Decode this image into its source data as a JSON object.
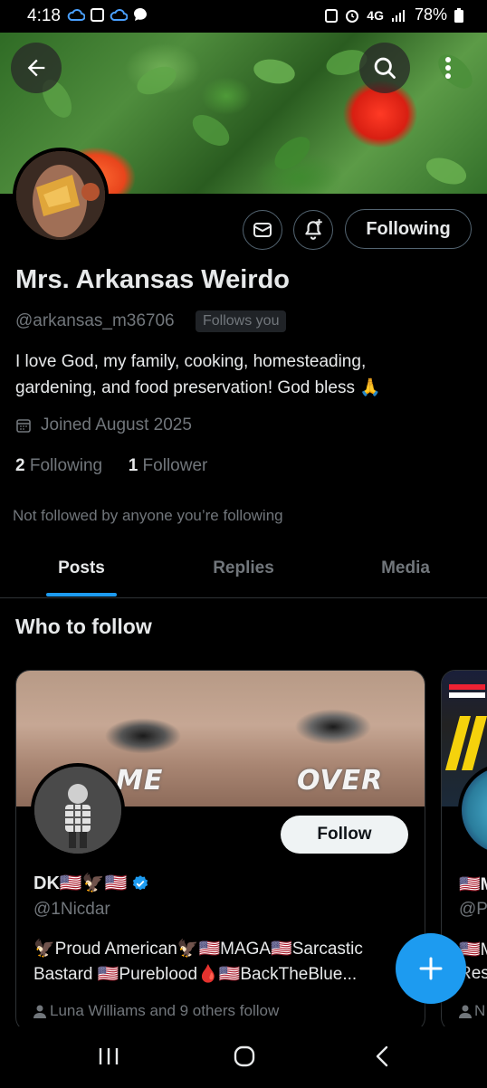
{
  "status_bar": {
    "time": "4:18",
    "network": "4G",
    "battery": "78%"
  },
  "profile": {
    "name": "Mrs. Arkansas Weirdo",
    "handle": "@arkansas_m36706",
    "follows_you_badge": "Follows you",
    "bio_line1": "I love God, my family, cooking,  homesteading,",
    "bio_line2": "gardening, and food preservation! God bless 🙏",
    "joined": "Joined August 2025",
    "following_count": "2",
    "following_label": "Following",
    "followers_count": "1",
    "followers_label": "Follower",
    "not_followed_text": "Not followed by anyone you’re following",
    "following_button": "Following"
  },
  "tabs": [
    {
      "label": "Posts",
      "active": true
    },
    {
      "label": "Replies",
      "active": false
    },
    {
      "label": "Media",
      "active": false
    }
  ],
  "who_to_follow": {
    "title": "Who to follow",
    "card": {
      "banner_text_left": "ME",
      "banner_text_right": "OVER",
      "name": "DK🇺🇸🦅🇺🇸",
      "handle": "@1Nicdar",
      "bio_line1": "🦅Proud American🦅🇺🇸MAGA🇺🇸Sarcastic",
      "bio_line2": "Bastard 🇺🇸Pureblood🩸🇺🇸BackTheBlue...",
      "social_context": "Luna Williams and 9 others follow",
      "follow_button": "Follow"
    },
    "card2": {
      "name_peek": "🇺🇸M",
      "handle_peek": "@P",
      "bio_peek1": "🇺🇸M",
      "bio_peek2": "Res",
      "social_peek": "N"
    },
    "peek_below": "Luna Williams and 9 others follow"
  },
  "colors": {
    "accent": "#1d9bf0",
    "secondary_text": "#71767b",
    "background": "#000000"
  },
  "icons": [
    "back-arrow-icon",
    "search-icon",
    "more-vertical-icon",
    "mail-icon",
    "bell-plus-icon",
    "calendar-icon",
    "verified-badge-icon",
    "person-icon",
    "plus-icon",
    "recents-icon",
    "home-icon",
    "nav-back-icon"
  ]
}
